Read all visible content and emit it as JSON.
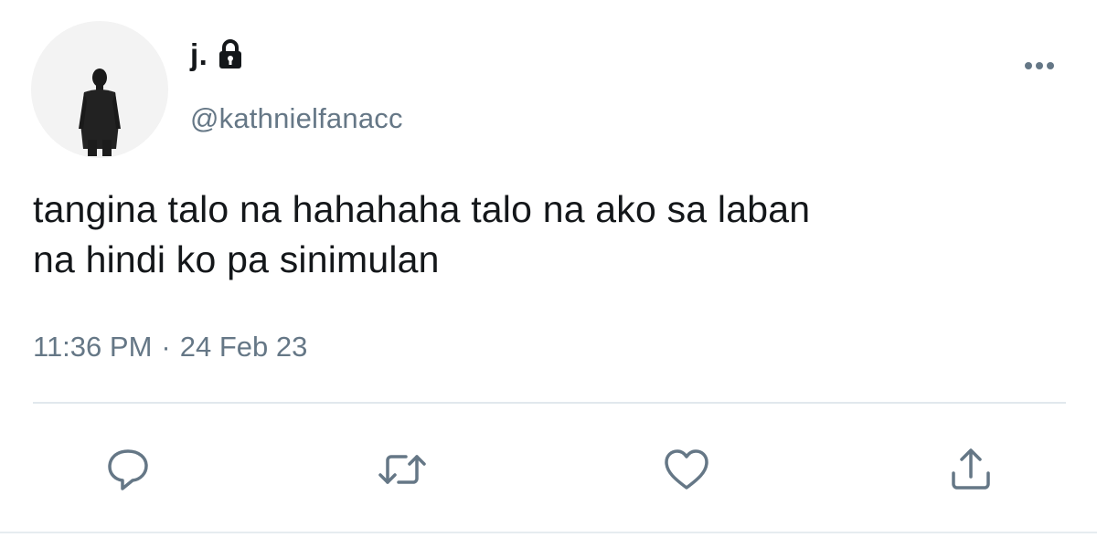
{
  "user": {
    "display_name": "j.",
    "handle": "@kathnielfanacc",
    "protected": true,
    "verified_icon": "lock-icon"
  },
  "tweet": {
    "text_line_1": "tangina talo na hahahaha talo na ako sa laban",
    "text_line_2": "na hindi ko pa sinimulan",
    "time": "11:36 PM",
    "separator": "·",
    "date": "24 Feb 23"
  },
  "actions": [
    {
      "name": "reply",
      "icon": "speech-bubble-icon"
    },
    {
      "name": "retweet",
      "icon": "retweet-icon"
    },
    {
      "name": "like",
      "icon": "heart-icon"
    },
    {
      "name": "share",
      "icon": "share-upload-icon"
    }
  ],
  "colors": {
    "text_primary": "#14171a",
    "text_secondary": "#657786",
    "icon": "#657786",
    "divider": "#e1e8ed"
  }
}
